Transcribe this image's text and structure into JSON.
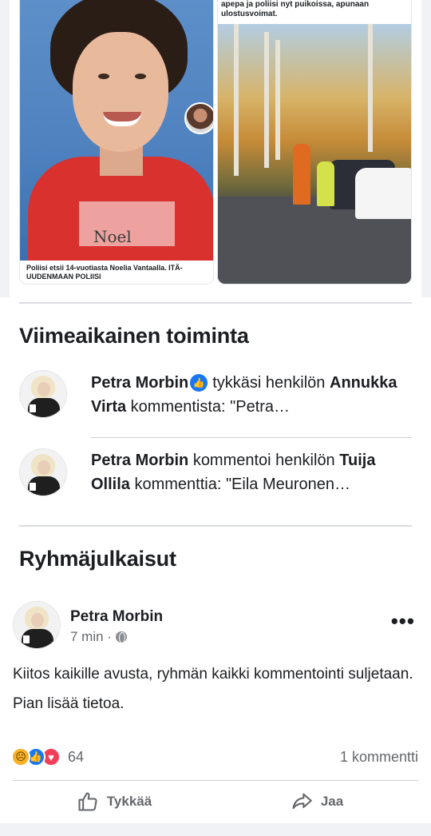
{
  "media": {
    "left_caption": "Poliisi etsii 14-vuotiasta Noelia Vantaalla. ITÄ-UUDENMAAN POLIISI",
    "shirt_text": "Noel",
    "right_caption": "apepa ja poliisi nyt puikoissa, apunaan ulostusvoimat."
  },
  "recent_activity": {
    "title": "Viimeaikainen toiminta",
    "items": [
      {
        "actor": "Petra Morbin",
        "verb": "tykkäsi henkilön",
        "target": "Annukka Virta",
        "rest": "kommentista: \"Petra…"
      },
      {
        "actor": "Petra Morbin",
        "verb": "kommentoi henkilön",
        "target": "Tuija Ollila",
        "rest": "kommenttia: \"Eila Meuronen…"
      }
    ]
  },
  "group_posts": {
    "title": "Ryhmäjulkaisut",
    "post": {
      "author": "Petra Morbin",
      "time": "7 min ·",
      "paragraphs": [
        "Kiitos kaikille avusta, ryhmän kaikki kommentointi suljetaan.",
        "Pian lisää tietoa."
      ],
      "reaction_count": "64",
      "comment_count": "1 kommentti",
      "like_label": "Tykkää",
      "share_label": "Jaa"
    }
  },
  "icons": {
    "like": "thumbs-up-icon",
    "share": "share-arrow-icon",
    "privacy": "globe-icon",
    "more": "more-dots-icon"
  },
  "colors": {
    "facebook_blue": "#1877f2",
    "love_red": "#f33e58",
    "sad_yellow": "#f7b125",
    "secondary_text": "#65676b"
  }
}
